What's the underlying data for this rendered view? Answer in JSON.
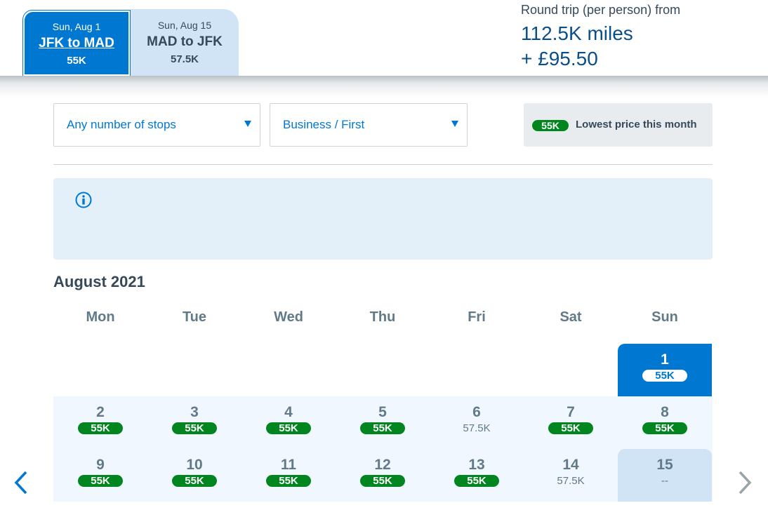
{
  "header": {
    "legs": [
      {
        "date": "Sun, Aug 1",
        "route": "JFK to MAD",
        "price": "55K",
        "active": true
      },
      {
        "date": "Sun, Aug 15",
        "route": "MAD to JFK",
        "price": "57.5K",
        "active": false
      }
    ],
    "summary": {
      "label": "Round trip (per person) from",
      "miles": "112.5K miles",
      "fee": "+ £95.50"
    }
  },
  "filters": {
    "stops": {
      "value": "Any number of stops"
    },
    "cabin": {
      "value": "Business / First"
    }
  },
  "legend": {
    "pill": "55K",
    "text": "Lowest price this month"
  },
  "info": {
    "icon": "info-icon"
  },
  "calendar": {
    "month": "August 2021",
    "weekdays": [
      "Mon",
      "Tue",
      "Wed",
      "Thu",
      "Fri",
      "Sat",
      "Sun"
    ],
    "weeks": [
      [
        null,
        null,
        null,
        null,
        null,
        null,
        {
          "day": "1",
          "price": "55K",
          "lowest": true,
          "state": "selected"
        }
      ],
      [
        {
          "day": "2",
          "price": "55K",
          "lowest": true
        },
        {
          "day": "3",
          "price": "55K",
          "lowest": true
        },
        {
          "day": "4",
          "price": "55K",
          "lowest": true
        },
        {
          "day": "5",
          "price": "55K",
          "lowest": true
        },
        {
          "day": "6",
          "price": "57.5K",
          "lowest": false
        },
        {
          "day": "7",
          "price": "55K",
          "lowest": true
        },
        {
          "day": "8",
          "price": "55K",
          "lowest": true
        }
      ],
      [
        {
          "day": "9",
          "price": "55K",
          "lowest": true
        },
        {
          "day": "10",
          "price": "55K",
          "lowest": true
        },
        {
          "day": "11",
          "price": "55K",
          "lowest": true
        },
        {
          "day": "12",
          "price": "55K",
          "lowest": true
        },
        {
          "day": "13",
          "price": "55K",
          "lowest": true
        },
        {
          "day": "14",
          "price": "57.5K",
          "lowest": false
        },
        {
          "day": "15",
          "price": "--",
          "lowest": false,
          "state": "return"
        }
      ]
    ],
    "nav": {
      "prev": "chevron-left-icon",
      "next": "chevron-right-icon"
    }
  },
  "colors": {
    "primary": "#0078d2",
    "lowest_price": "#00851f",
    "return_highlight": "#d0e4f5",
    "info_bg": "#e3f0fa",
    "text": "#36495a"
  }
}
